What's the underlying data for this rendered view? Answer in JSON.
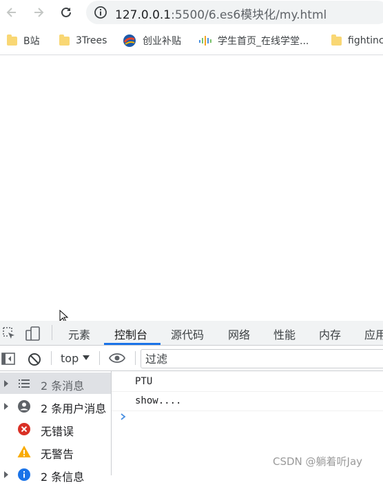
{
  "browser": {
    "url_host": "127.0.0.1",
    "url_rest": ":5500/6.es6模块化/my.html",
    "bookmarks": [
      {
        "label": "B站",
        "icon": "folder-icon"
      },
      {
        "label": "3Trees",
        "icon": "folder-icon"
      },
      {
        "label": "创业补贴",
        "icon": "site-logo-icon"
      },
      {
        "label": "学生首页_在线学堂...",
        "icon": "bars-icon"
      },
      {
        "label": "fightinc",
        "icon": "folder-icon"
      }
    ]
  },
  "devtools": {
    "tabs": [
      "元素",
      "控制台",
      "源代码",
      "网络",
      "性能",
      "内存",
      "应用"
    ],
    "active_tab": "控制台",
    "context": "top",
    "filter_placeholder": "过滤",
    "sidebar": [
      {
        "label": "2 条消息",
        "icon": "list-icon",
        "selected": true
      },
      {
        "label": "2 条用户消息",
        "icon": "user-icon",
        "selected": false
      },
      {
        "label": "无错误",
        "icon": "error-icon",
        "selected": false
      },
      {
        "label": "无警告",
        "icon": "warning-icon",
        "selected": false
      },
      {
        "label": "2 条信息",
        "icon": "info-icon",
        "selected": false
      }
    ],
    "messages": [
      "PTU",
      "show...."
    ]
  },
  "watermark": "CSDN @躺着听Jay",
  "colors": {
    "accent": "#1a73e8",
    "error": "#d93025",
    "warning": "#f9ab00",
    "info": "#1a73e8"
  }
}
